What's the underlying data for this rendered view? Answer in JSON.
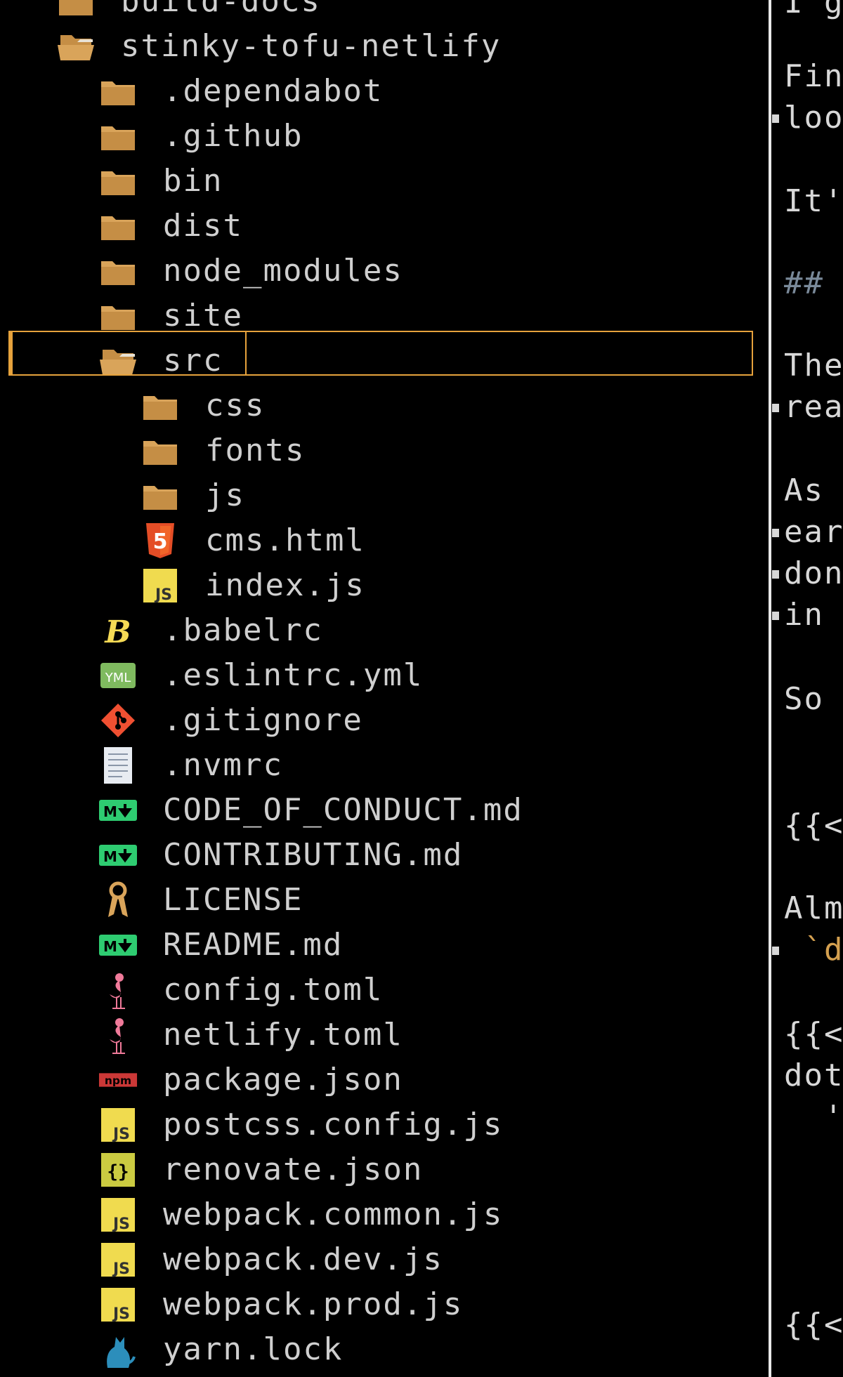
{
  "tree": {
    "items": [
      {
        "label": "build-docs",
        "depth": 1,
        "icon": "folder-icon",
        "kind": "folder"
      },
      {
        "label": "stinky-tofu-netlify",
        "depth": 1,
        "icon": "folder-open-icon",
        "kind": "folder-open"
      },
      {
        "label": ".dependabot",
        "depth": 2,
        "icon": "folder-icon",
        "kind": "folder"
      },
      {
        "label": ".github",
        "depth": 2,
        "icon": "folder-icon",
        "kind": "folder"
      },
      {
        "label": "bin",
        "depth": 2,
        "icon": "folder-icon",
        "kind": "folder"
      },
      {
        "label": "dist",
        "depth": 2,
        "icon": "folder-icon",
        "kind": "folder"
      },
      {
        "label": "node_modules",
        "depth": 2,
        "icon": "folder-icon",
        "kind": "folder"
      },
      {
        "label": "site",
        "depth": 2,
        "icon": "folder-icon",
        "kind": "folder"
      },
      {
        "label": "src",
        "depth": 2,
        "icon": "folder-open-icon",
        "kind": "folder-open",
        "selected": true
      },
      {
        "label": "css",
        "depth": 3,
        "icon": "folder-icon",
        "kind": "folder"
      },
      {
        "label": "fonts",
        "depth": 3,
        "icon": "folder-icon",
        "kind": "folder"
      },
      {
        "label": "js",
        "depth": 3,
        "icon": "folder-icon",
        "kind": "folder"
      },
      {
        "label": "cms.html",
        "depth": 3,
        "icon": "html5-icon",
        "kind": "html"
      },
      {
        "label": "index.js",
        "depth": 3,
        "icon": "javascript-icon",
        "kind": "js"
      },
      {
        "label": ".babelrc",
        "depth": 2,
        "icon": "babel-icon",
        "kind": "babel"
      },
      {
        "label": ".eslintrc.yml",
        "depth": 2,
        "icon": "yaml-icon",
        "kind": "yml"
      },
      {
        "label": ".gitignore",
        "depth": 2,
        "icon": "git-icon",
        "kind": "git"
      },
      {
        "label": ".nvmrc",
        "depth": 2,
        "icon": "text-file-icon",
        "kind": "text"
      },
      {
        "label": "CODE_OF_CONDUCT.md",
        "depth": 2,
        "icon": "markdown-icon",
        "kind": "md"
      },
      {
        "label": "CONTRIBUTING.md",
        "depth": 2,
        "icon": "markdown-icon",
        "kind": "md"
      },
      {
        "label": "LICENSE",
        "depth": 2,
        "icon": "license-icon",
        "kind": "license"
      },
      {
        "label": "README.md",
        "depth": 2,
        "icon": "markdown-icon",
        "kind": "md"
      },
      {
        "label": "config.toml",
        "depth": 2,
        "icon": "toml-flamingo-icon",
        "kind": "toml"
      },
      {
        "label": "netlify.toml",
        "depth": 2,
        "icon": "toml-flamingo-icon",
        "kind": "toml"
      },
      {
        "label": "package.json",
        "depth": 2,
        "icon": "npm-icon",
        "kind": "npm"
      },
      {
        "label": "postcss.config.js",
        "depth": 2,
        "icon": "javascript-icon",
        "kind": "js"
      },
      {
        "label": "renovate.json",
        "depth": 2,
        "icon": "json-icon",
        "kind": "json"
      },
      {
        "label": "webpack.common.js",
        "depth": 2,
        "icon": "javascript-icon",
        "kind": "js"
      },
      {
        "label": "webpack.dev.js",
        "depth": 2,
        "icon": "javascript-icon",
        "kind": "js"
      },
      {
        "label": "webpack.prod.js",
        "depth": 2,
        "icon": "javascript-icon",
        "kind": "js"
      },
      {
        "label": "yarn.lock",
        "depth": 2,
        "icon": "yarn-cat-icon",
        "kind": "yarn"
      }
    ]
  },
  "editor": {
    "lines": [
      {
        "text": "I g",
        "wrap": false,
        "cls": ""
      },
      {
        "text": "Fin",
        "wrap": false,
        "cls": ""
      },
      {
        "text": "loo",
        "wrap": true,
        "cls": ""
      },
      {
        "text": "It'",
        "wrap": false,
        "cls": ""
      },
      {
        "text": "##",
        "wrap": false,
        "cls": "hdr"
      },
      {
        "text": "The",
        "wrap": false,
        "cls": ""
      },
      {
        "text": "rea",
        "wrap": true,
        "cls": ""
      },
      {
        "text": "As",
        "wrap": false,
        "cls": ""
      },
      {
        "text": "ear",
        "wrap": true,
        "cls": ""
      },
      {
        "text": "don",
        "wrap": true,
        "cls": ""
      },
      {
        "text": "in",
        "wrap": true,
        "cls": ""
      },
      {
        "text": "So",
        "wrap": false,
        "cls": ""
      },
      {
        "text": "{{<",
        "wrap": false,
        "cls": ""
      },
      {
        "text": "Alm",
        "wrap": false,
        "cls": ""
      },
      {
        "text": " `do",
        "wrap": true,
        "cls": "str"
      },
      {
        "text": "{{<",
        "wrap": false,
        "cls": ""
      },
      {
        "text": "dot",
        "wrap": false,
        "cls": ""
      },
      {
        "text": "  '",
        "wrap": false,
        "cls": ""
      },
      {
        "text": "{{<",
        "wrap": false,
        "cls": ""
      }
    ]
  }
}
